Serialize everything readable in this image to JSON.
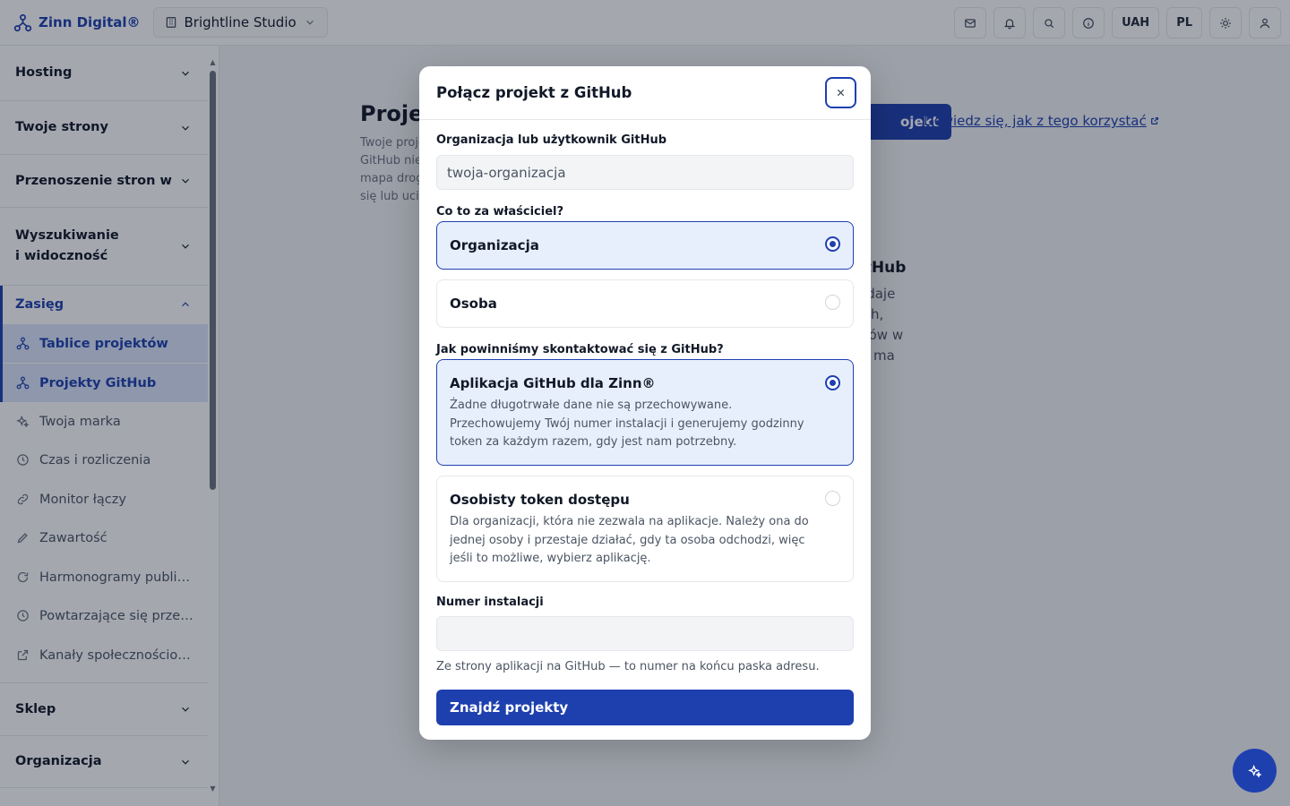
{
  "brand": {
    "name": "Zinn Digital®",
    "studio": "Brightline Studio"
  },
  "topbar": {
    "currency": "UAH",
    "language": "PL"
  },
  "sidebar": {
    "sections": [
      {
        "label": "Hosting"
      },
      {
        "label": "Twoje strony"
      },
      {
        "label": "Przenoszenie stron w"
      },
      {
        "label": "Wyszukiwanie\ni widoczność"
      },
      {
        "label": "Zasięg"
      },
      {
        "label": "Sklep"
      },
      {
        "label": "Organizacja"
      }
    ],
    "items": [
      {
        "label": "Tablice projektów",
        "icon": "board-icon"
      },
      {
        "label": "Projekty GitHub",
        "icon": "github-project-icon"
      },
      {
        "label": "Twoja marka",
        "icon": "sparkle-icon"
      },
      {
        "label": "Czas i rozliczenia",
        "icon": "clock-icon"
      },
      {
        "label": "Monitor łączy",
        "icon": "link-icon"
      },
      {
        "label": "Zawartość",
        "icon": "pencil-icon"
      },
      {
        "label": "Harmonogramy publika...",
        "icon": "refresh-icon"
      },
      {
        "label": "Powtarzające się przebi...",
        "icon": "clock-icon"
      },
      {
        "label": "Kanały społecznościowe",
        "icon": "external-link-icon"
      }
    ]
  },
  "page": {
    "title": "Projel",
    "desc_lines": [
      "Twoje proje",
      "GitHub nie",
      "mapa drog",
      "się lub ucie"
    ],
    "add_button": "ojekt",
    "learn_link": "Dowiedz się, jak z tego korzystać",
    "card_title": "GitHub",
    "card_lines": [
      "co daje",
      "tkich,",
      "entów w",
      "coś ma"
    ]
  },
  "modal": {
    "title": "Połącz projekt z GitHub",
    "org_label": "Organizacja lub użytkownik GitHub",
    "org_placeholder": "twoja-organizacja",
    "owner_label": "Co to za właściciel?",
    "owner_options": [
      {
        "label": "Organizacja",
        "selected": true
      },
      {
        "label": "Osoba",
        "selected": false
      }
    ],
    "contact_label": "Jak powinniśmy skontaktować się z GitHub?",
    "contact_options": [
      {
        "label": "Aplikacja GitHub dla Zinn®",
        "desc": "Żadne długotrwałe dane nie są przechowywane. Przechowujemy Twój numer instalacji i generujemy godzinny token za każdym razem, gdy jest nam potrzebny.",
        "selected": true
      },
      {
        "label": "Osobisty token dostępu",
        "desc": "Dla organizacji, która nie zezwala na aplikacje. Należy ona do jednej osoby i przestaje działać, gdy ta osoba odchodzi, więc jeśli to możliwe, wybierz aplikację.",
        "selected": false
      }
    ],
    "install_label": "Numer instalacji",
    "install_value": "",
    "install_hint": "Ze strony aplikacji na GitHub — to numer na końcu paska adresu.",
    "submit_label": "Znajdź projekty"
  },
  "colors": {
    "accent": "#1e40af",
    "selected_bg": "#e8effc"
  }
}
